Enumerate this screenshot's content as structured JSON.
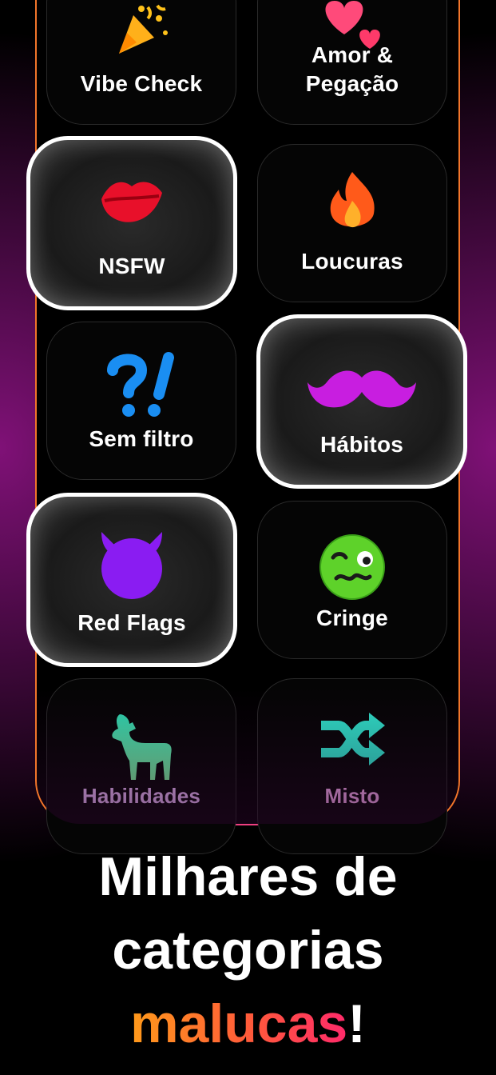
{
  "cards": [
    {
      "label": "Vibe Check",
      "icon": "party-popper-icon"
    },
    {
      "label": "Amor & Pegação",
      "icon": "hearts-icon"
    },
    {
      "label": "NSFW",
      "icon": "kiss-lips-icon"
    },
    {
      "label": "Loucuras",
      "icon": "fire-icon"
    },
    {
      "label": "Sem filtro",
      "icon": "interrobang-icon"
    },
    {
      "label": "Hábitos",
      "icon": "mustache-icon"
    },
    {
      "label": "Red Flags",
      "icon": "devil-icon"
    },
    {
      "label": "Cringe",
      "icon": "woozy-face-icon"
    },
    {
      "label": "Habilidades",
      "icon": "goat-icon"
    },
    {
      "label": "Misto",
      "icon": "shuffle-icon"
    }
  ],
  "headline": {
    "line1": "Milhares de",
    "line2": "categorias",
    "accent": "malucas",
    "end": "!"
  },
  "colors": {
    "frame_orange": "#f2752a",
    "frame_pink": "#ee3f80",
    "lips": "#e8102a",
    "mustache": "#c81ee0",
    "devil": "#8a1cf2",
    "question": "#1a8ef2",
    "goat": "#43d9a6",
    "shuffle": "#2ee0c8",
    "habilidades_text": "#e6b8f5",
    "misto_text": "#f0a8e8"
  }
}
